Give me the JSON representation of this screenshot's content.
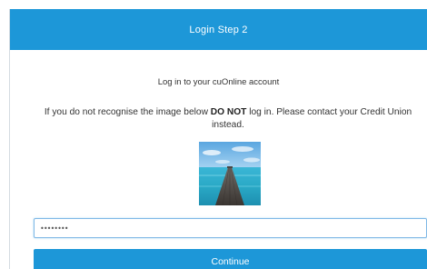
{
  "header": {
    "title": "Login Step 2"
  },
  "intro": {
    "text": "Log in to your cuOnline account"
  },
  "warning": {
    "prefix": "If you do not recognise the image below ",
    "emphasis": "DO NOT",
    "suffix": " log in. Please contact your Credit Union instead."
  },
  "security_image": {
    "icon": "pier-over-sea-photo"
  },
  "password": {
    "value": "••••••••"
  },
  "continue_button": {
    "label": "Continue"
  },
  "colors": {
    "accent": "#1d97d8",
    "input_border": "#7fb8e6"
  }
}
